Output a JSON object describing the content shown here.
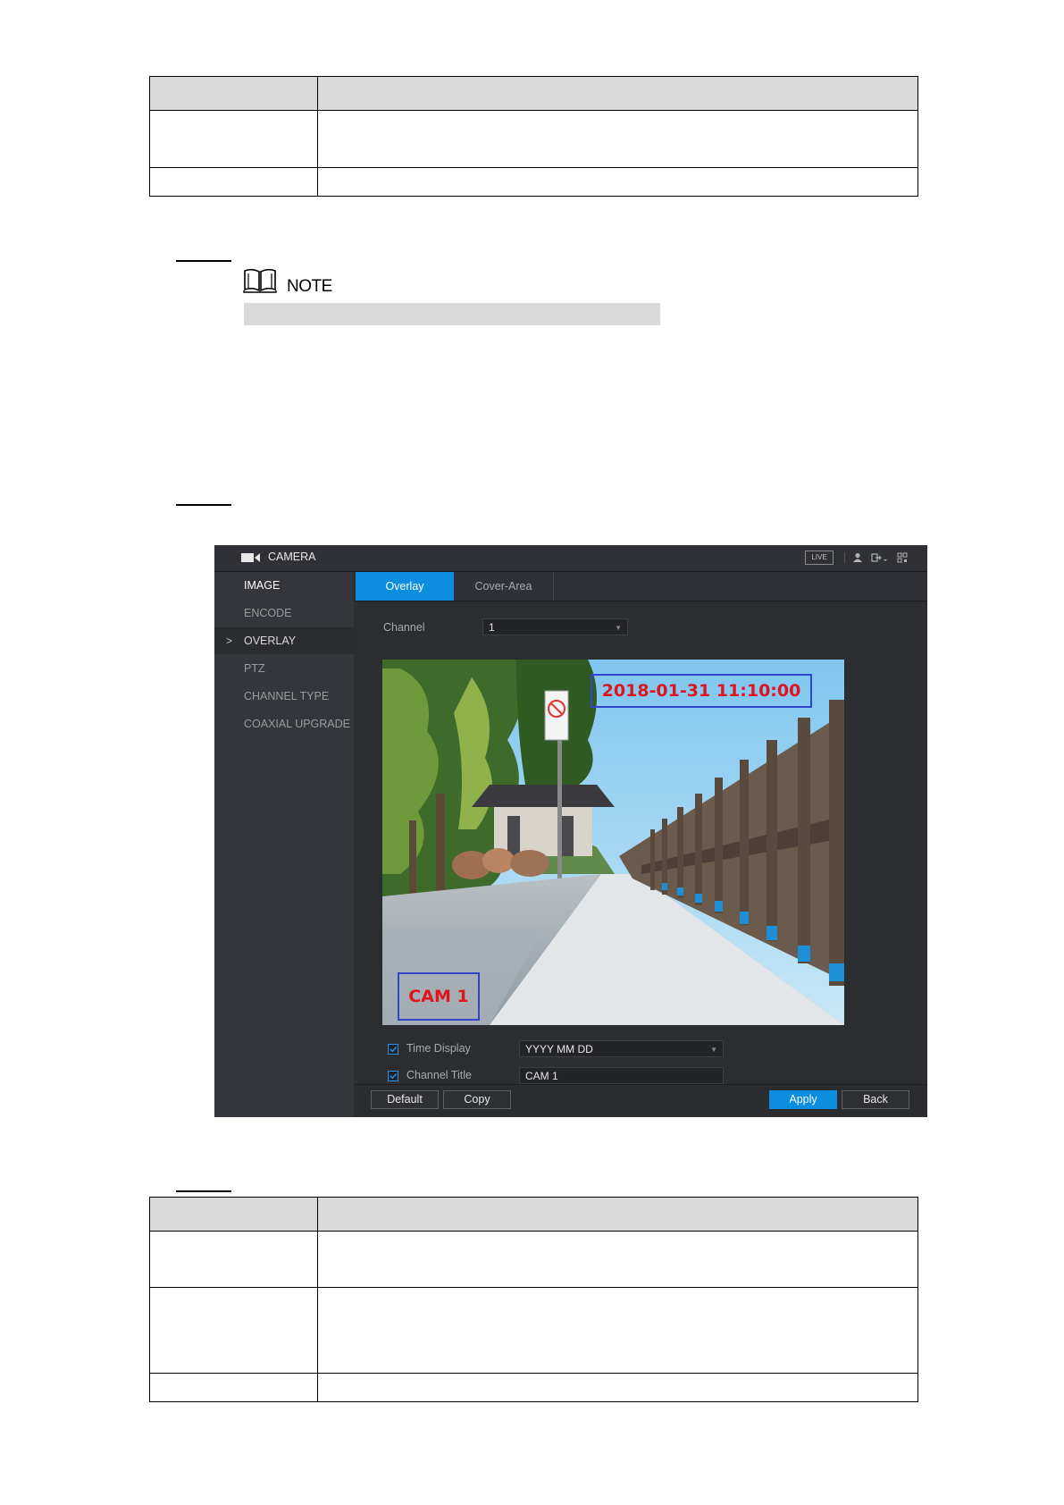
{
  "note": {
    "label": "NOTE"
  },
  "camera_ui": {
    "title": "CAMERA",
    "live_badge": "LIVE",
    "sidebar": {
      "items": [
        {
          "label": "IMAGE"
        },
        {
          "label": "ENCODE"
        },
        {
          "label": "OVERLAY",
          "selected": true
        },
        {
          "label": "PTZ"
        },
        {
          "label": "CHANNEL TYPE"
        },
        {
          "label": "COAXIAL UPGRADE"
        }
      ],
      "selected_marker": ">"
    },
    "tabs": [
      {
        "label": "Overlay",
        "active": true
      },
      {
        "label": "Cover-Area",
        "active": false
      }
    ],
    "channel": {
      "label": "Channel",
      "value": "1"
    },
    "preview": {
      "time_overlay": "2018-01-31 11:10:00",
      "title_overlay": "CAM 1"
    },
    "time_display": {
      "label": "Time Display",
      "checked": true,
      "value": "YYYY MM DD"
    },
    "channel_title": {
      "label": "Channel Title",
      "checked": true,
      "value": "CAM 1"
    },
    "buttons": {
      "default": "Default",
      "copy": "Copy",
      "apply": "Apply",
      "back": "Back"
    },
    "colors": {
      "accent": "#0c8ee0",
      "background": "#2b2d31",
      "overlay_text": "#e0141c",
      "overlay_box": "#3344cc"
    }
  }
}
